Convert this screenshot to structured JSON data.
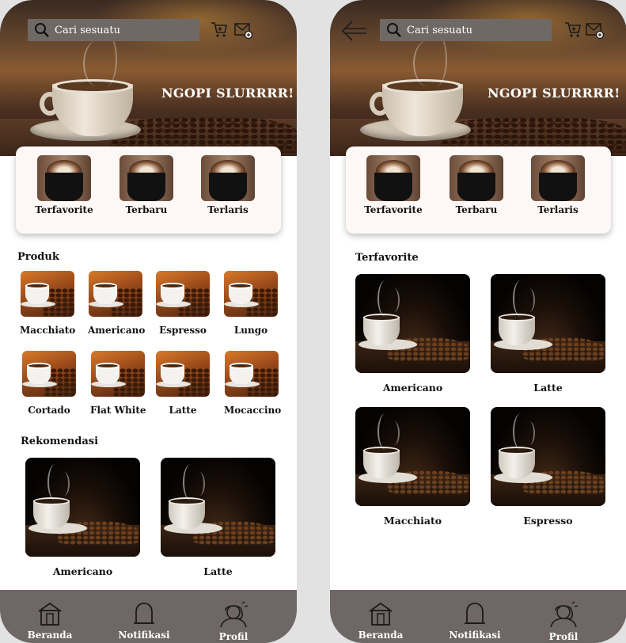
{
  "left": {
    "search": {
      "placeholder": "Cari sesuatu"
    },
    "tagline": "NGOPI SLURRRR!",
    "categories": [
      {
        "label": "Terfavorite"
      },
      {
        "label": "Terbaru"
      },
      {
        "label": "Terlaris"
      }
    ],
    "produk_title": "Produk",
    "products": [
      {
        "label": "Macchiato"
      },
      {
        "label": "Americano"
      },
      {
        "label": "Espresso"
      },
      {
        "label": "Lungo"
      },
      {
        "label": "Cortado"
      },
      {
        "label": "Flat White"
      },
      {
        "label": "Latte"
      },
      {
        "label": "Mocaccino"
      }
    ],
    "rekomendasi_title": "Rekomendasi",
    "recommendations": [
      {
        "label": "Americano"
      },
      {
        "label": "Latte"
      }
    ]
  },
  "right": {
    "search": {
      "placeholder": "Cari sesuatu"
    },
    "tagline": "NGOPI SLURRRR!",
    "categories": [
      {
        "label": "Terfavorite"
      },
      {
        "label": "Terbaru"
      },
      {
        "label": "Terlaris"
      }
    ],
    "section_title": "Terfavorite",
    "items": [
      {
        "label": "Americano"
      },
      {
        "label": "Latte"
      },
      {
        "label": "Macchiato"
      },
      {
        "label": "Espresso"
      }
    ]
  },
  "nav": [
    {
      "label": "Beranda",
      "icon": "home-icon"
    },
    {
      "label": "Notifikasi",
      "icon": "bell-icon"
    },
    {
      "label": "Profil",
      "icon": "profile-icon"
    }
  ],
  "colors": {
    "nav_bg": "#6e6766",
    "search_bg": "#6f6966",
    "card_bg": "#fdf8f6",
    "page_bg": "#e2e2e2"
  }
}
